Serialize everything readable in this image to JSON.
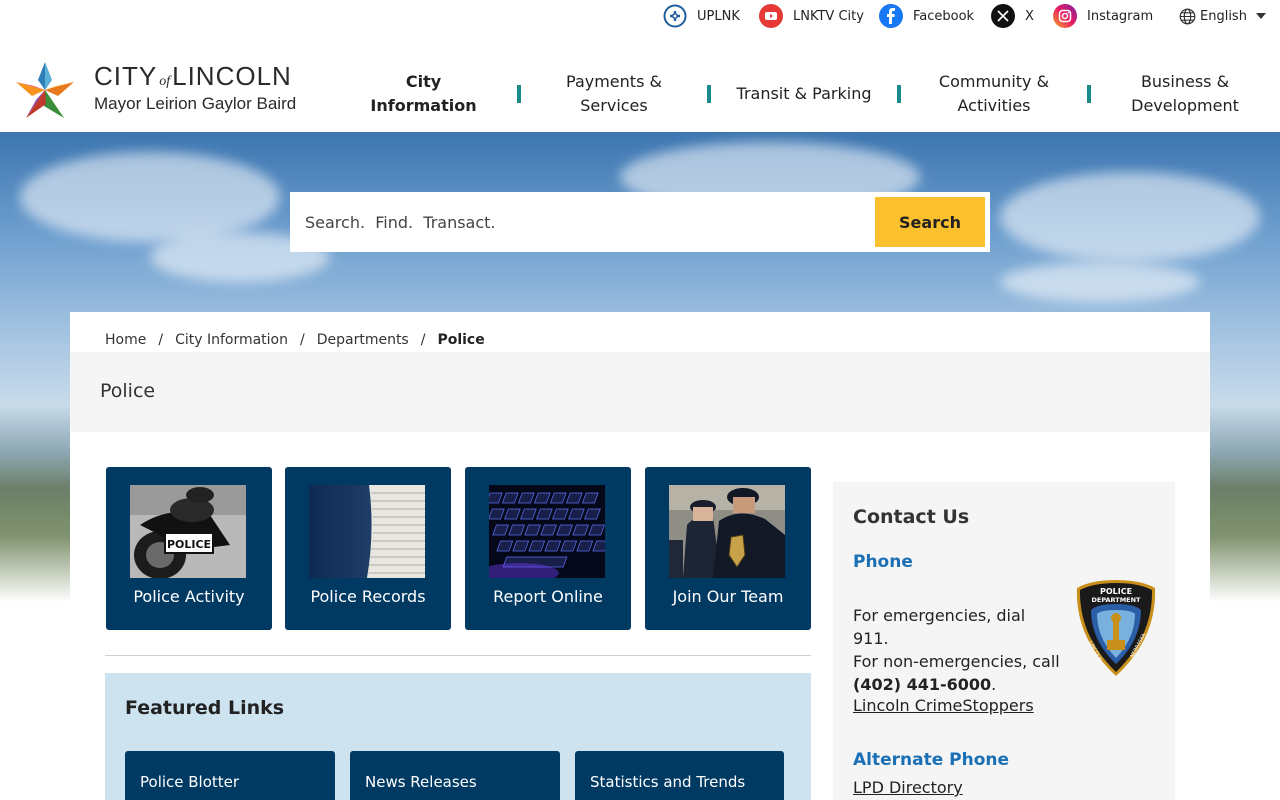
{
  "utility": {
    "links": [
      {
        "label": "UPLNK",
        "icon": "uplnk-icon",
        "color": "#1f5f9e"
      },
      {
        "label": "LNKTV City",
        "icon": "youtube-icon",
        "color": "#e53935"
      },
      {
        "label": "Facebook",
        "icon": "facebook-icon",
        "color": "#1877f2"
      },
      {
        "label": "X",
        "icon": "x-icon",
        "color": "#111111"
      },
      {
        "label": "Instagram",
        "icon": "instagram-icon",
        "color": "#d6249f"
      }
    ],
    "language": "English"
  },
  "logo": {
    "city": "CITY",
    "of": "of",
    "name": "LINCOLN",
    "mayor": "Mayor Leirion Gaylor Baird"
  },
  "nav": [
    {
      "label": "City Information",
      "active": true
    },
    {
      "label": "Payments & Services"
    },
    {
      "label": "Transit & Parking"
    },
    {
      "label": "Community & Activities"
    },
    {
      "label": "Business & Development"
    }
  ],
  "search": {
    "placeholder": "Search.  Find.  Transact.",
    "button": "Search"
  },
  "breadcrumb": {
    "items": [
      "Home",
      "City Information",
      "Departments"
    ],
    "current": "Police"
  },
  "page_title": "Police",
  "tiles": [
    {
      "label": "Police Activity",
      "image": "police-motorcycle"
    },
    {
      "label": "Police Records",
      "image": "paper-stack"
    },
    {
      "label": "Report Online",
      "image": "keyboard"
    },
    {
      "label": "Join Our Team",
      "image": "officers"
    }
  ],
  "featured": {
    "title": "Featured Links",
    "links": [
      "Police Blotter",
      "News Releases",
      "Statistics and Trends"
    ]
  },
  "contact": {
    "title": "Contact Us",
    "phone_heading": "Phone",
    "line1": "For emergencies, dial 911.",
    "line2": "For non-emergencies, call",
    "phone_number": "(402) 441-6000",
    "period": ".",
    "crimestoppers": "Lincoln CrimeStoppers",
    "alt_heading": "Alternate Phone",
    "directory": "LPD Directory",
    "badge_text": {
      "top": "POLICE",
      "mid": "DEPARTMENT",
      "left": "LINCOLN",
      "right": "NEBRASKA"
    }
  },
  "colors": {
    "navy": "#003a63",
    "accent_yellow": "#fbc02d",
    "teal_separator": "#1a8a8a",
    "link_blue": "#1a6fb5",
    "featured_bg": "#cde3ef"
  }
}
